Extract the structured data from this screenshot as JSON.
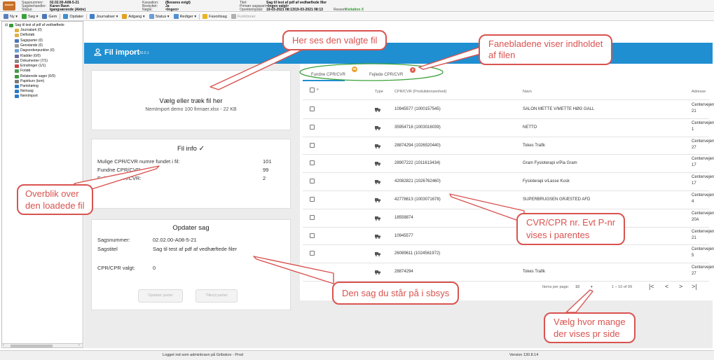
{
  "case_header": {
    "sagsnummer_label": "Sagsnummer:",
    "sagsnummer_value": "02.02.00-A08-5-21",
    "sagsbehandler_label": "Sagsbehandler:",
    "sagsbehandler_value": "Karen Ravn",
    "status_label": "Status:",
    "status_value": "Igangværende (Aktiv)",
    "kassation_label": "Kassation:",
    "kassation_value": "(Bevares evigt)",
    "beskyttet_label": "Beskyttet:",
    "beskyttet_value": "Ja",
    "noegle_label": "Nøgle:",
    "noegle_value": "<Ingen>",
    "titel_label": "Titel:",
    "titel_value": "Sag til test af pdf af vedhæftede filer",
    "primaer_label": "Primær sagspart:",
    "primaer_value": "<Ingen valgt>",
    "oprettet_label": "Oprettet/opdat:",
    "oprettet_value": "19-03-2021 08:13/19-03-2021 08:13",
    "ressort_label": "Ressort:",
    "ressort_value": "Visitation X"
  },
  "toolbar": {
    "items": [
      {
        "label": "Ny ▾",
        "color": "#5a7fbf",
        "disabled": false
      },
      {
        "label": "Søg ▾",
        "color": "#3aa03a",
        "disabled": false
      },
      {
        "label": "Gem",
        "color": "#4a76b8",
        "disabled": false
      },
      {
        "label": "Opdater",
        "color": "#3f8fcf",
        "disabled": false
      },
      {
        "label": "Journaliser ▾",
        "color": "#3f7fc8",
        "disabled": false
      },
      {
        "label": "Adgang ▾",
        "color": "#e0a21e",
        "disabled": false
      },
      {
        "label": "Status ▾",
        "color": "#6a9fd8",
        "disabled": false
      },
      {
        "label": "Rediger ▾",
        "color": "#4f8fcf",
        "disabled": false
      },
      {
        "label": "Favoritsag",
        "color": "#e8b51f",
        "disabled": false
      },
      {
        "label": "Funktioner",
        "color": "#b0b0b0",
        "disabled": true
      }
    ]
  },
  "tree": {
    "items": [
      {
        "label": "Sag til test af pdf af vedhæftede",
        "color": "#3a9a3a",
        "indent": 0
      },
      {
        "label": "Journalark (0)",
        "color": "#e0b040",
        "indent": 1
      },
      {
        "label": "Delforløb",
        "color": "#e0b040",
        "indent": 1
      },
      {
        "label": "Sagsparter (0)",
        "color": "#4a76b8",
        "indent": 1
      },
      {
        "label": "Genstande (0)",
        "color": "#9a9a9a",
        "indent": 1
      },
      {
        "label": "Dagsordenpunkter (0)",
        "color": "#6aa0d8",
        "indent": 1
      },
      {
        "label": "Kladder (0/0)",
        "color": "#6a6aa0",
        "indent": 1
      },
      {
        "label": "Dokumenter (7/1)",
        "color": "#8a8a8a",
        "indent": 1
      },
      {
        "label": "Erindringer (1/1)",
        "color": "#d04040",
        "indent": 1
      },
      {
        "label": "Forløb",
        "color": "#4a9a4a",
        "indent": 1
      },
      {
        "label": "Relaterede sager (0/0)",
        "color": "#3a9a3a",
        "indent": 1
      },
      {
        "label": "Papirkurv (tom)",
        "color": "#7a7a7a",
        "indent": 1
      },
      {
        "label": "Partshøring",
        "color": "#2a7ac8",
        "indent": 1
      },
      {
        "label": "Nemsag",
        "color": "#2a7ac8",
        "indent": 1
      },
      {
        "label": "NemImport",
        "color": "#2a7ac8",
        "indent": 1
      }
    ]
  },
  "app": {
    "title": "Fil import",
    "version": "v. 130.0.1"
  },
  "upload": {
    "title": "Vælg eller træk fil her",
    "filename": "NemImport demo 100 firmaer.xlsx - 22 KB"
  },
  "fil_info": {
    "title": "Fil info",
    "rows": [
      {
        "label": "Mulige CPR/CVR numre fundet i fil:",
        "value": "101"
      },
      {
        "label": "Fundne CPR/CVR",
        "value": "99"
      },
      {
        "label": "Fejlede CPR/CVR:",
        "value": "2"
      }
    ]
  },
  "opdater_sag": {
    "title": "Opdater sag",
    "sagsnummer_label": "Sagsnummer:",
    "sagsnummer_value": "02.02.00-A08-5-21",
    "sagstitel_label": "Sagstitel",
    "sagstitel_value": "Sag til test af pdf af vedhæftede filer",
    "cpr_label": "CPR/CPR valgt:",
    "cpr_value": "0",
    "btn_opdater": "Opdater parter",
    "btn_tilknyt": "Tilknyt parter"
  },
  "tabs": [
    {
      "label": "Fundne CPR/CVR",
      "badge": "99",
      "badge_color": "#e8a22a"
    },
    {
      "label": "Fejlede CPR/CVR",
      "badge": "2",
      "badge_color": "#e06050"
    }
  ],
  "table": {
    "header_count": "0",
    "columns": {
      "type": "Type",
      "cpr": "CPR/CVR (Produktionsenhed)",
      "navn": "Navn",
      "adresse": "Adresse"
    },
    "rows": [
      {
        "cpr": "10945577 (1000157545)",
        "navn": "SALON METTE V/METTE HØG GALL",
        "adresse1": "Centervejen",
        "adresse2": "21"
      },
      {
        "cpr": "35954716 (1003016039)",
        "navn": "NETTO",
        "adresse1": "Centervejen",
        "adresse2": "1"
      },
      {
        "cpr": "28874294 (1026520440)",
        "navn": "Tokes Trafik",
        "adresse1": "Centervejen",
        "adresse2": "27"
      },
      {
        "cpr": "28907222 (1011613434)",
        "navn": "Gram Fysioterapi v/Pia Gram",
        "adresse1": "Centervejen",
        "adresse2": "17"
      },
      {
        "cpr": "42082821 (1026762460)",
        "navn": "Fysioterapi v/Lasse Kusk",
        "adresse1": "Centervejen",
        "adresse2": "17"
      },
      {
        "cpr": "42778613 (1003071678)",
        "navn": "SUPERBRUGSEN GRÆSTED AFD",
        "adresse1": "Centervejen",
        "adresse2": "4"
      },
      {
        "cpr": "18558874",
        "navn": "",
        "adresse1": "Centervejen",
        "adresse2": "20A"
      },
      {
        "cpr": "10945577",
        "navn": "",
        "adresse1": "Centervejen",
        "adresse2": "21"
      },
      {
        "cpr": "26089611 (1024561972)",
        "navn": "",
        "adresse1": "Centervejen",
        "adresse2": "5"
      },
      {
        "cpr": "28874294",
        "navn": "Tokes Trafik",
        "adresse1": "Centervejen",
        "adresse2": "27"
      }
    ]
  },
  "pager": {
    "items_per_page_label": "Items per page:",
    "items_per_page_value": "10",
    "range": "1 – 10 of 99"
  },
  "status_bar": {
    "logged_in": "Logget ind som adminkravn på Gribskov - Prod",
    "version": "Version 130.8.14"
  },
  "annotations": {
    "valgte_fil": "Her ses den valgte fil",
    "fanebladene_1": "Fanebladene viser indholdet",
    "fanebladene_2": "af filen",
    "overblik_1": "Overblik over",
    "overblik_2": "den loadede fil",
    "cvr_1": "CVR/CPR nr. Evt P-nr",
    "cvr_2": "vises i parentes",
    "sag": "Den sag du står på i sbsys",
    "vaelg_1": "Vælg hvor mange",
    "vaelg_2": "der vises pr side"
  },
  "colors": {
    "accent": "#1f8fd1",
    "annotation": "#d9534f",
    "tab_highlight": "#3aa03a"
  }
}
